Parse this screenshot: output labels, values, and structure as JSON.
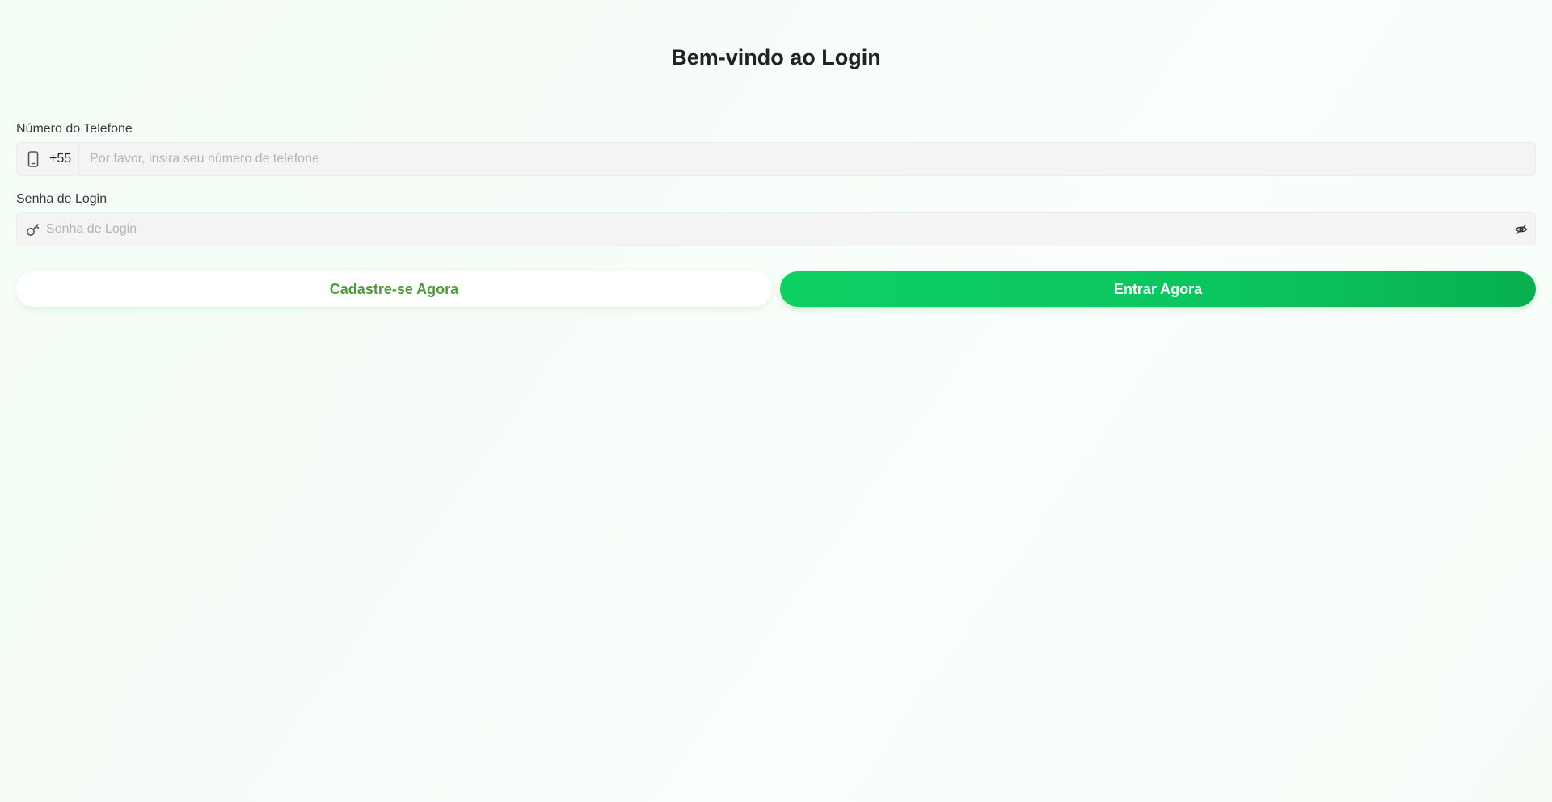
{
  "page": {
    "title": "Bem-vindo ao Login"
  },
  "phone": {
    "label": "Número do Telefone",
    "country_code": "+55",
    "placeholder": "Por favor, insira seu número de telefone",
    "icon": "phone-icon"
  },
  "password": {
    "label": "Senha de Login",
    "placeholder": "Senha de Login",
    "icon": "key-icon",
    "toggle_icon": "eye-off-icon"
  },
  "actions": {
    "register_label": "Cadastre-se Agora",
    "login_label": "Entrar Agora"
  },
  "colors": {
    "brand_green": "#0dd063",
    "register_text": "#4e9a3a"
  }
}
